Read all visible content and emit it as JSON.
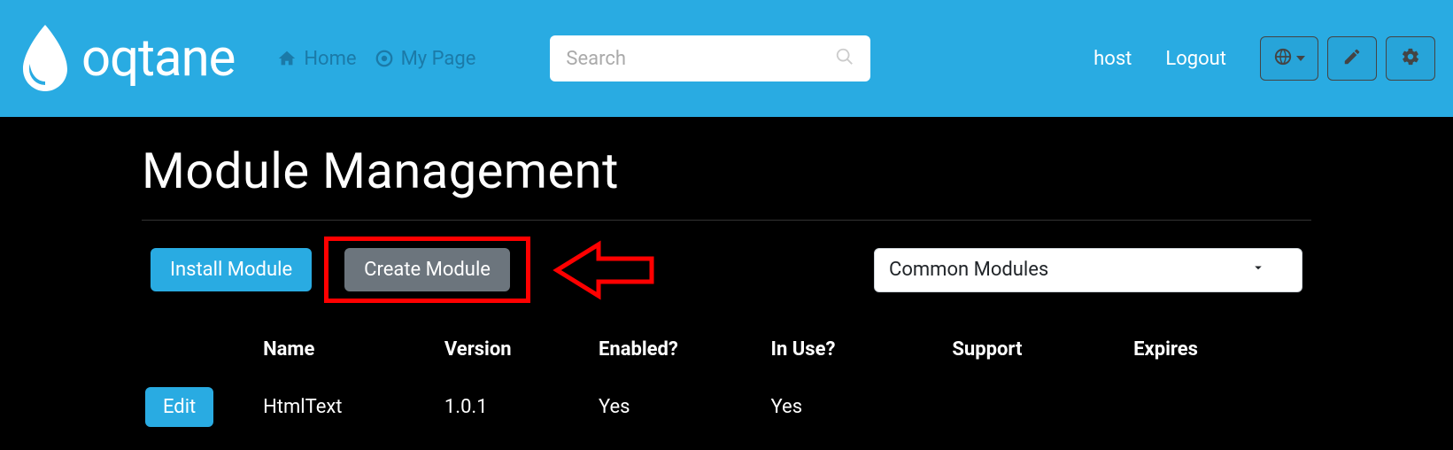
{
  "header": {
    "logo_text": "oqtane",
    "nav": [
      {
        "label": "Home"
      },
      {
        "label": "My Page"
      }
    ],
    "search_placeholder": "Search",
    "user": "host",
    "logout": "Logout"
  },
  "page": {
    "title": "Module Management",
    "install_label": "Install Module",
    "create_label": "Create Module",
    "filter_selected": "Common Modules"
  },
  "table": {
    "columns": {
      "name": "Name",
      "version": "Version",
      "enabled": "Enabled?",
      "inuse": "In Use?",
      "support": "Support",
      "expires": "Expires"
    },
    "rows": [
      {
        "edit_label": "Edit",
        "name": "HtmlText",
        "version": "1.0.1",
        "enabled": "Yes",
        "inuse": "Yes",
        "support": "",
        "expires": ""
      }
    ]
  }
}
